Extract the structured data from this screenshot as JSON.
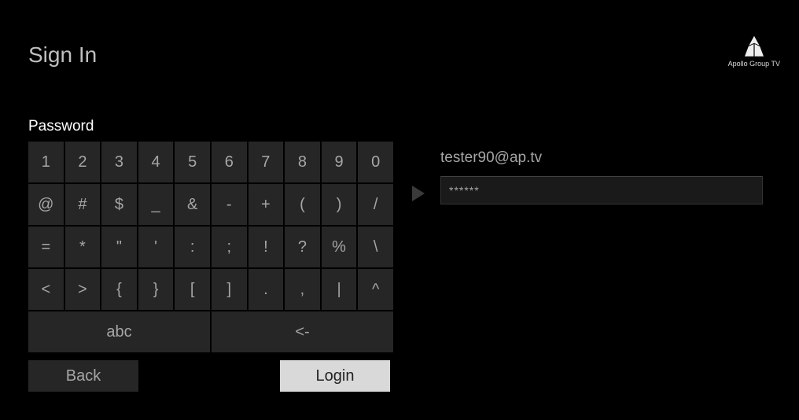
{
  "brand": {
    "name": "Apollo Group TV"
  },
  "page": {
    "title": "Sign In",
    "passwordLabel": "Password"
  },
  "inputs": {
    "email": "tester90@ap.tv",
    "passwordMasked": "******"
  },
  "keyboard": {
    "rows": [
      [
        "1",
        "2",
        "3",
        "4",
        "5",
        "6",
        "7",
        "8",
        "9",
        "0"
      ],
      [
        "@",
        "#",
        "$",
        "_",
        "&",
        "-",
        "+",
        "(",
        ")",
        "/"
      ],
      [
        "=",
        "*",
        "\"",
        "'",
        ":",
        ";",
        "!",
        "?",
        "%",
        "\\"
      ],
      [
        "<",
        ">",
        "{",
        "}",
        "[",
        "]",
        ".",
        ",",
        "|",
        "^"
      ]
    ],
    "modeKey": "abc",
    "backspaceKey": "<-"
  },
  "actions": {
    "back": "Back",
    "login": "Login"
  }
}
